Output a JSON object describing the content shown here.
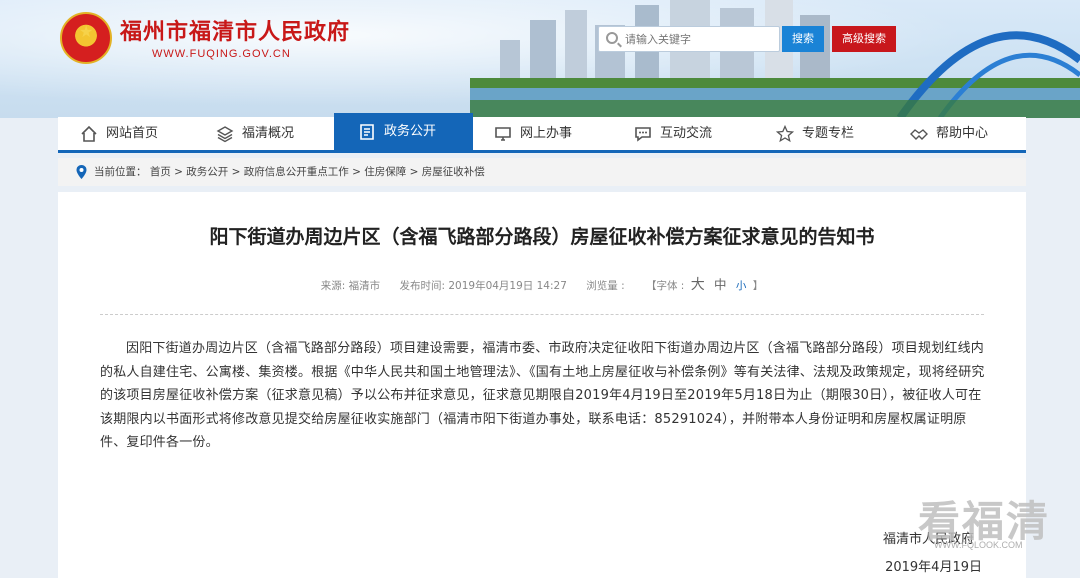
{
  "header": {
    "site_title": "福州市福清市人民政府",
    "site_url": "WWW.FUQING.GOV.CN",
    "search_placeholder": "请输入关键字",
    "search_button": "搜索",
    "advanced_search_button": "高级搜索"
  },
  "nav": {
    "items": [
      {
        "label": "网站首页",
        "icon": "home-icon"
      },
      {
        "label": "福清概况",
        "icon": "layers-icon"
      },
      {
        "label": "政务公开",
        "icon": "document-icon",
        "active": true
      },
      {
        "label": "网上办事",
        "icon": "monitor-icon"
      },
      {
        "label": "互动交流",
        "icon": "chat-icon"
      },
      {
        "label": "专题专栏",
        "icon": "star-icon"
      },
      {
        "label": "帮助中心",
        "icon": "handshake-icon"
      }
    ]
  },
  "breadcrumb": {
    "text": "当前位置： 首页 > 政务公开 > 政府信息公开重点工作 > 住房保障 > 房屋征收补偿"
  },
  "article": {
    "title": "阳下街道办周边片区（含福飞路部分路段）房屋征收补偿方案征求意见的告知书",
    "source": "来源: 福清市",
    "publish_time": "发布时间: 2019年04月19日 14:27",
    "views": "浏览量 :",
    "font_label": "【字体 :",
    "font_big": "大",
    "font_mid": "中",
    "font_small": "小",
    "font_end": "】",
    "body": "因阳下街道办周边片区（含福飞路部分路段）项目建设需要，福清市委、市政府决定征收阳下街道办周边片区（含福飞路部分路段）项目规划红线内的私人自建住宅、公寓楼、集资楼。根据《中华人民共和国土地管理法》、《国有土地上房屋征收与补偿条例》等有关法律、法规及政策规定，现将经研究的该项目房屋征收补偿方案（征求意见稿）予以公布并征求意见，征求意见期限自2019年4月19日至2019年5月18日为止（期限30日），被征收人可在该期限内以书面形式将修改意见提交给房屋征收实施部门（福清市阳下街道办事处，联系电话：85291024），并附带本人身份证明和房屋权属证明原件、复印件各一份。",
    "signer": "福清市人民政府",
    "date": "2019年4月19日"
  },
  "watermark": {
    "text": "看福清",
    "url": "WWW.FQLOOK.COM"
  },
  "colors": {
    "brand_red": "#c81818",
    "nav_blue": "#1466b8",
    "search_blue": "#1a83d6"
  }
}
